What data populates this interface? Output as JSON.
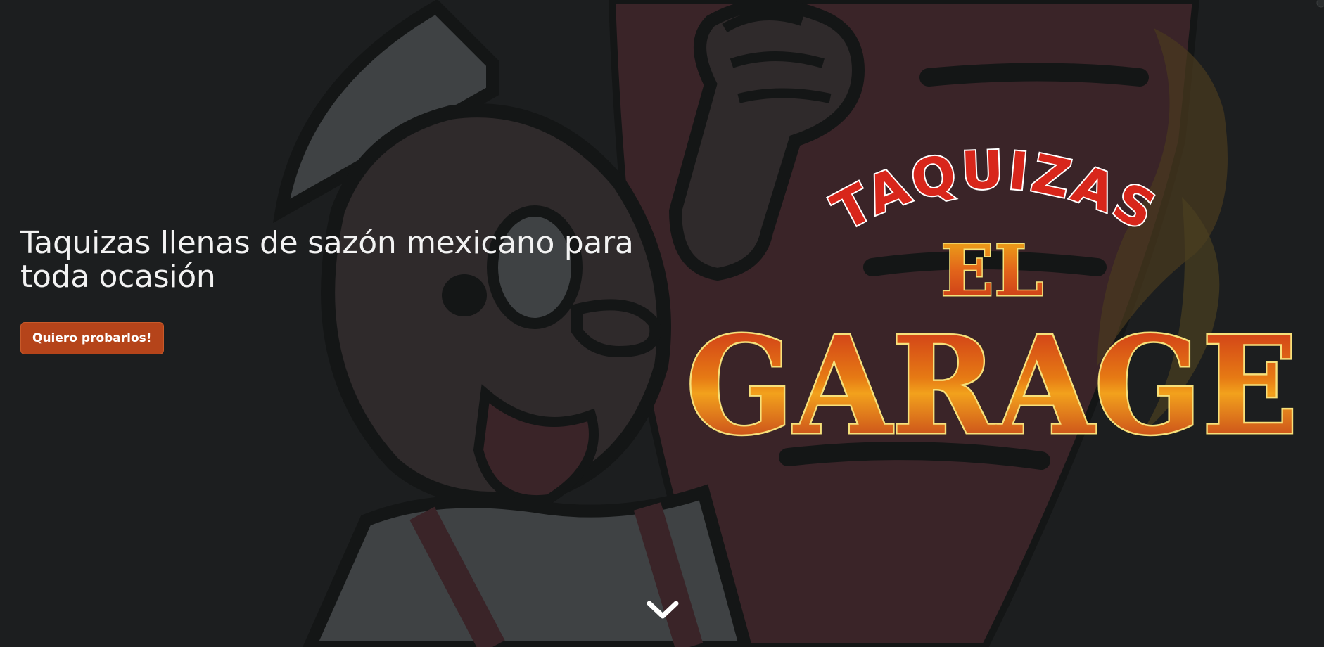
{
  "hero": {
    "headline": "Taquizas llenas de sazón mexicano para toda ocasión",
    "cta_label": "Quiero probarlos!",
    "background_icon": "cartoon-chef-mascot",
    "scroll_icon": "chevron-down-icon"
  },
  "logo": {
    "line1": "TAQUIZAS",
    "line2": "EL",
    "line3": "GARAGE"
  },
  "colors": {
    "background": "#1c1e1f",
    "accent": "#b5441a",
    "logo_red": "#d8261b",
    "logo_gold": "#f2c12e"
  }
}
